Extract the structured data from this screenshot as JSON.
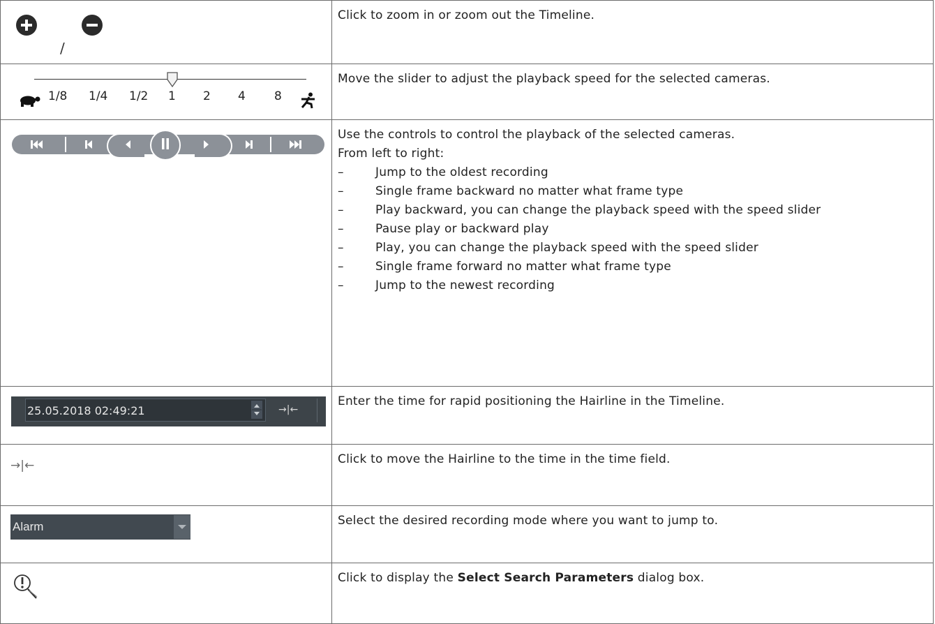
{
  "rows": [
    {
      "description": "Click to zoom in or zoom out the Timeline.",
      "left": {
        "type": "zoom",
        "separator": "/",
        "icons": [
          "zoom-in-icon",
          "zoom-out-icon"
        ]
      }
    },
    {
      "description": "Move the slider to adjust the playback speed for the selected cameras.",
      "left": {
        "type": "speed-slider",
        "labels": [
          "1/8",
          "1/4",
          "1/2",
          "1",
          "2",
          "4",
          "8"
        ],
        "selected": "1",
        "icons": [
          "turtle-icon",
          "runner-icon"
        ]
      }
    },
    {
      "description_lines": [
        "Use the controls to control the playback of the selected cameras.",
        "From left to right:"
      ],
      "bullets": [
        "Jump to the oldest recording",
        "Single frame backward no matter what frame type",
        "Play backward, you can change the playback speed with the speed slider",
        "Pause play or backward play",
        "Play, you can change the playback speed with the speed slider",
        "Single frame forward no matter what frame type",
        "Jump to the newest recording"
      ],
      "bullet_marker": "–",
      "left": {
        "type": "playback-controls",
        "icons": [
          "skip-to-start-icon",
          "step-back-icon",
          "play-backward-icon",
          "pause-icon",
          "play-icon",
          "step-forward-icon",
          "skip-to-end-icon"
        ]
      }
    },
    {
      "description": "Enter the time for rapid positioning the Hairline in the Timeline.",
      "left": {
        "type": "time-field",
        "value": "25.05.2018 02:49:21",
        "icons": [
          "spinner-icon",
          "go-to-hairline-icon"
        ]
      }
    },
    {
      "description": "Click to move the Hairline to the time in the time field.",
      "left": {
        "type": "hairline-button",
        "icon": "go-to-hairline-icon",
        "glyph": "→|←"
      }
    },
    {
      "description": "Select the desired recording mode where you want to jump to.",
      "left": {
        "type": "dropdown",
        "value": "Alarm",
        "icon": "chevron-down-icon"
      }
    },
    {
      "description_parts": [
        "Click to display the ",
        "Select Search Parameters",
        " dialog box."
      ],
      "left": {
        "type": "search-button",
        "icon": "search-parameters-icon"
      }
    }
  ],
  "colors": {
    "border": "#6b6b6b",
    "control_gray": "#8c9198",
    "field_dark": "#2e3439",
    "panel_dark": "#3d4449"
  }
}
